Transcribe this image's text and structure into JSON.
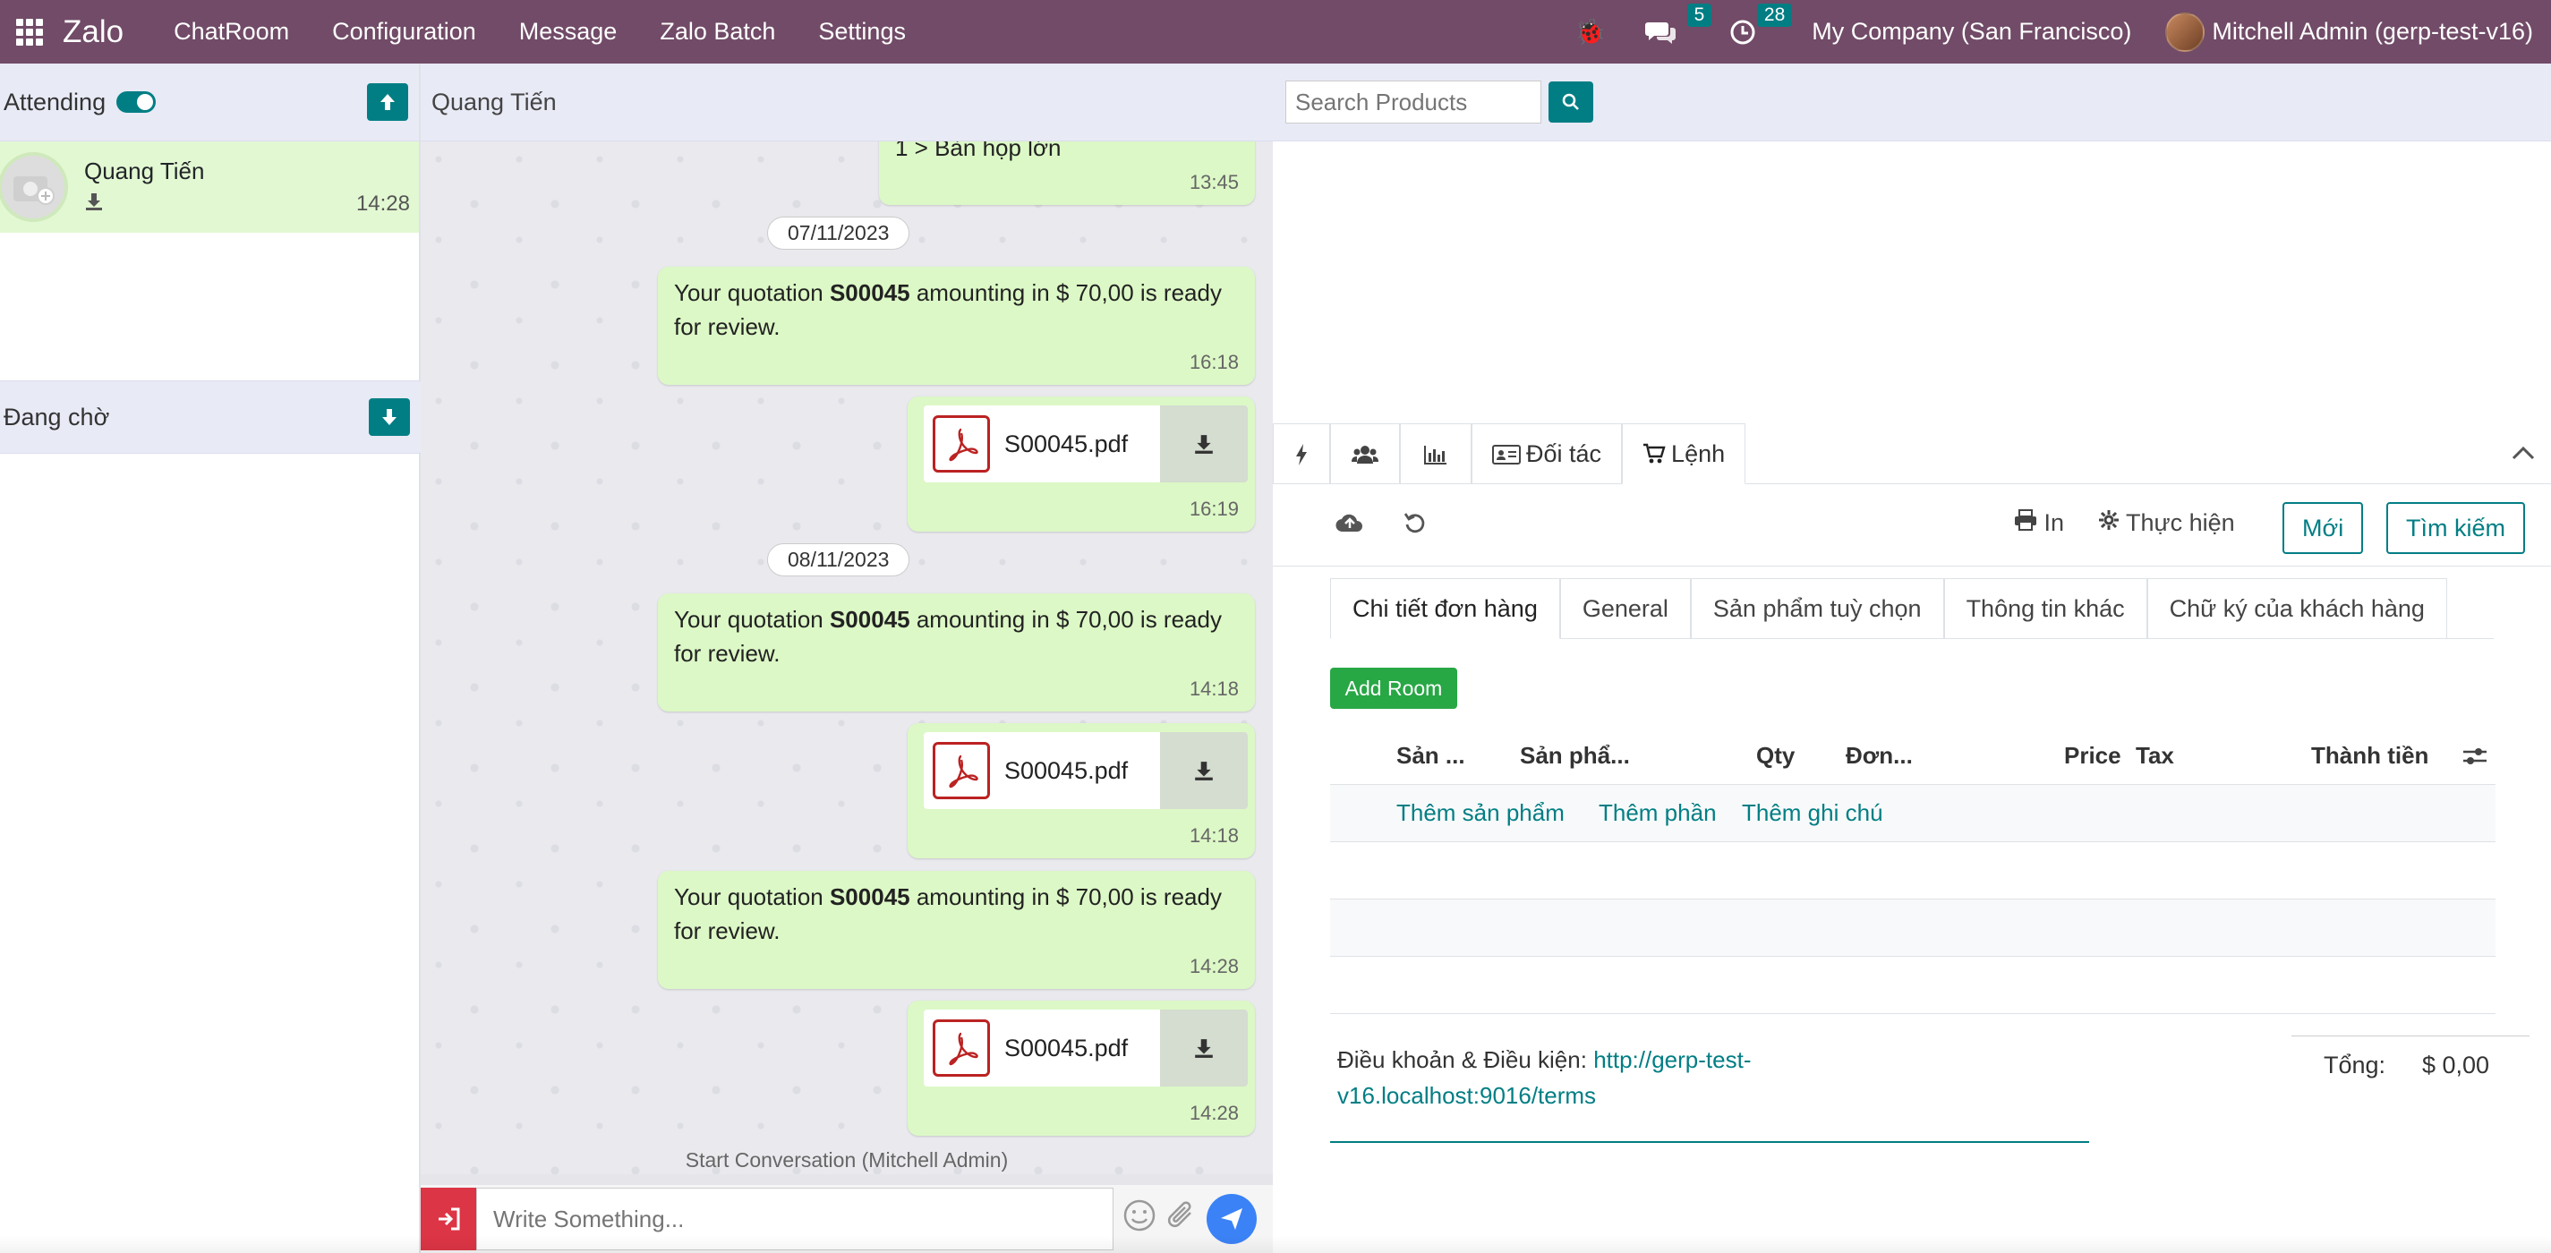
{
  "app": {
    "brand": "Zalo",
    "menu": [
      "ChatRoom",
      "Configuration",
      "Message",
      "Zalo Batch",
      "Settings"
    ]
  },
  "systray": {
    "messages_count": "5",
    "activities_count": "28",
    "company": "My Company (San Francisco)",
    "user": "Mitchell Admin (gerp-test-v16)"
  },
  "sidebar": {
    "attending_label": "Attending",
    "waiting_label": "Đang chờ",
    "conversations": [
      {
        "name": "Quang Tiến",
        "time": "14:28"
      }
    ]
  },
  "chat": {
    "title": "Quang Tiến",
    "first_partial": {
      "text": "1 > Bàn họp lớn",
      "time": "13:45"
    },
    "dates": [
      "07/11/2023",
      "08/11/2023"
    ],
    "messages": [
      {
        "pre": "Your quotation ",
        "bold": "S00045",
        "post": " amounting in $ 70,00 is ready for review.",
        "time": "16:18"
      },
      {
        "file": "S00045.pdf",
        "time": "16:19"
      },
      {
        "pre": "Your quotation ",
        "bold": "S00045",
        "post": " amounting in $ 70,00 is ready for review.",
        "time": "14:18"
      },
      {
        "file": "S00045.pdf",
        "time": "14:18"
      },
      {
        "pre": "Your quotation ",
        "bold": "S00045",
        "post": " amounting in $ 70,00 is ready for review.",
        "time": "14:28"
      },
      {
        "file": "S00045.pdf",
        "time": "14:28"
      }
    ],
    "start_conversation": "Start Conversation (Mitchell Admin)",
    "input_placeholder": "Write Something..."
  },
  "products": {
    "search_placeholder": "Search Products"
  },
  "panel": {
    "tabs": [
      "Đối tác",
      "Lệnh"
    ],
    "toolbar": {
      "print_label": "In",
      "action_label": "Thực hiện",
      "new_label": "Mới",
      "search_label": "Tìm kiếm"
    },
    "form_tabs": [
      "Chi tiết đơn hàng",
      "General",
      "Sản phẩm tuỳ chọn",
      "Thông tin khác",
      "Chữ ký của khách hàng"
    ],
    "add_room_label": "Add Room",
    "columns": [
      "Sản ...",
      "Sản phẩ...",
      "Qty",
      "Đơn...",
      "Price",
      "Tax",
      "Thành tiền"
    ],
    "row_actions": [
      "Thêm sản phẩm",
      "Thêm phần",
      "Thêm ghi chú"
    ],
    "terms_label": "Điều khoản & Điều kiện:",
    "terms_link": "http://gerp-test-v16.localhost:9016/terms",
    "total_label": "Tổng:",
    "total_value": "$ 0,00"
  },
  "colors": {
    "brand": "#714b67",
    "accent": "#017e84",
    "bubble": "#dcf8c6",
    "danger": "#dc3545",
    "success": "#28a745"
  }
}
